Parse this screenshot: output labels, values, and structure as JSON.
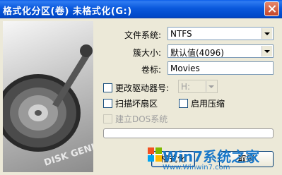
{
  "window": {
    "title": "格式化分区(卷) 未格式化(G:)"
  },
  "disk_brand": "DISK GENIUS",
  "form": {
    "filesystem": {
      "label": "文件系统:",
      "value": "NTFS"
    },
    "cluster": {
      "label": "簇大小:",
      "value": "默认值(4096)"
    },
    "volume": {
      "label": "卷标:",
      "value": "Movies"
    },
    "drive_letter": {
      "label": "更改驱动器号:",
      "value": "H:",
      "checked": false,
      "enabled": false
    },
    "scan_bad": {
      "label": "扫描坏扇区",
      "checked": false
    },
    "compress": {
      "label": "启用压缩",
      "checked": false
    },
    "dos_system": {
      "label": "建立DOS系统",
      "checked": false,
      "enabled": false
    }
  },
  "progress": {
    "value": 0.0
  },
  "buttons": {
    "format": "格式化",
    "cancel": "取消"
  },
  "watermark": {
    "main": "Win7系统之家",
    "url": "Www.Winwin7.com"
  }
}
